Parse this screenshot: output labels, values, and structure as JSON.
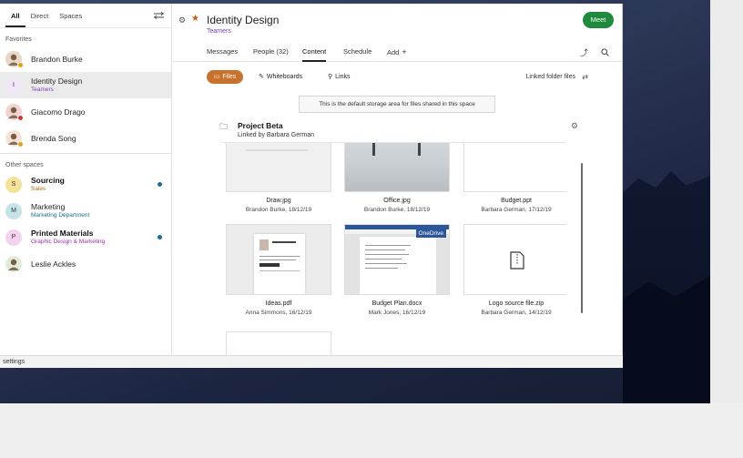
{
  "sidebar": {
    "tabs": [
      "All",
      "Direct",
      "Spaces"
    ],
    "favorites_label": "Favorites",
    "favorites": [
      {
        "name": "Brandon Burke",
        "initial": "",
        "avatar_color": "#e9d7c5",
        "status_color": "#e0a21a"
      },
      {
        "name": "Identity Design",
        "sub": "Teamers",
        "sub_color": "#7a3fb0",
        "initial": "I",
        "avatar_color": "#efe6f7"
      },
      {
        "name": "Giacomo Drago",
        "initial": "",
        "avatar_color": "#f0d4cf",
        "status_color": "#d13438"
      },
      {
        "name": "Brenda Song",
        "initial": "",
        "avatar_color": "#f3e2d5",
        "status_color": "#e0a21a"
      }
    ],
    "other_label": "Other spaces",
    "others": [
      {
        "name": "Sourcing",
        "sub": "Sales",
        "sub_color": "#b4690e",
        "initial": "S",
        "avatar_color": "#f3e29a",
        "bold": true,
        "unread": true
      },
      {
        "name": "Marketing",
        "sub": "Marketing Department",
        "sub_color": "#1a6f8f",
        "initial": "M",
        "avatar_color": "#c7e3ea",
        "bold": false,
        "unread": false
      },
      {
        "name": "Printed Materials",
        "sub": "Graphic Design & Marketing",
        "sub_color": "#9b30b0",
        "initial": "P",
        "avatar_color": "#f4d3ee",
        "bold": true,
        "unread": true
      },
      {
        "name": "Leslie Ackles",
        "initial": "",
        "avatar_color": "#dfeed9",
        "bold": false,
        "unread": false
      }
    ]
  },
  "status_bar": "settings",
  "header": {
    "title": "Identity Design",
    "subtitle": "Teamers",
    "meet_label": "Meet"
  },
  "tabs": {
    "messages": "Messages",
    "people": "People (32)",
    "content": "Content",
    "schedule": "Schedule",
    "add": "Add"
  },
  "subbar": {
    "files": "Files",
    "whiteboards": "Whiteboards",
    "links": "Links",
    "linked_folder": "Linked folder files"
  },
  "notice": "This is the default storage area for files shared in this space",
  "folder": {
    "title": "Project Beta",
    "linked_by": "Linked by Barbara German"
  },
  "files": [
    {
      "name": "Draw.jpg",
      "meta": "Brandon Burke, 18/12/19",
      "thumb": "draw"
    },
    {
      "name": "Office.jpg",
      "meta": "Brandon Burke, 18/12/19",
      "thumb": "office"
    },
    {
      "name": "Budget.ppt",
      "meta": "Barbara German, 17/12/19",
      "thumb": "budget"
    },
    {
      "name": "Ideas.pdf",
      "meta": "Anna Simmons, 16/12/19",
      "thumb": "ideas"
    },
    {
      "name": "Budget Plan.docx",
      "meta": "Mark Jones, 16/12/19",
      "thumb": "docx",
      "badge": "OneDrive"
    },
    {
      "name": "Logo source file.zip",
      "meta": "Barbara German, 14/12/19",
      "thumb": "zip"
    },
    {
      "name": "",
      "meta": "",
      "thumb": "blank"
    }
  ]
}
